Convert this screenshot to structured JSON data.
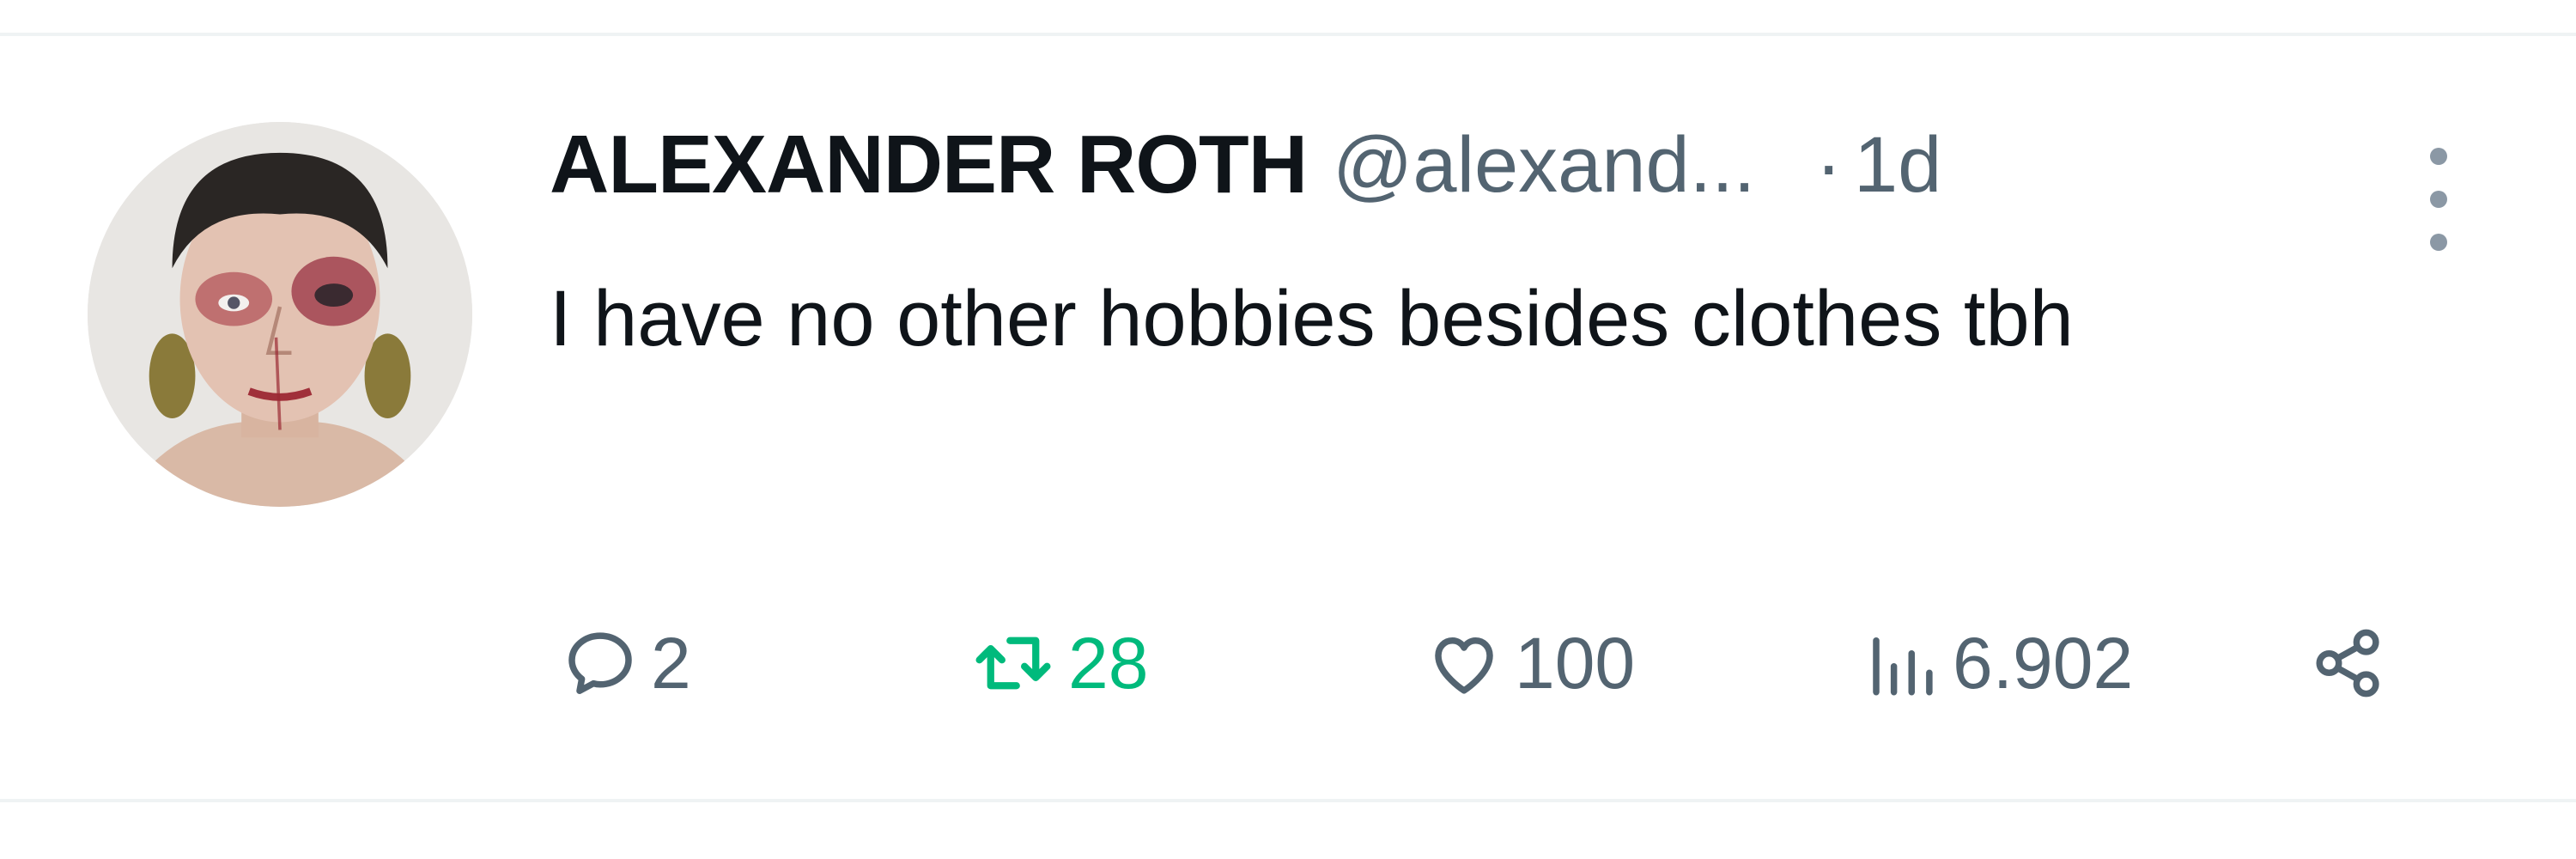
{
  "tweet": {
    "display_name": "ALEXANDER ROTH",
    "handle": "@alexand...",
    "separator": "·",
    "time": "1d",
    "text": "I have no other hobbies besides clothes tbh"
  },
  "actions": {
    "reply_count": "2",
    "retweet_count": "28",
    "like_count": "100",
    "view_count": "6.902"
  },
  "icons": {
    "reply": "reply-icon",
    "retweet": "retweet-icon",
    "like": "heart-icon",
    "views": "views-icon",
    "share": "share-icon",
    "more": "more-icon"
  },
  "colors": {
    "text_primary": "#0f1419",
    "text_secondary": "#536471",
    "retweet_active": "#00ba7c",
    "divider": "#eff3f4"
  }
}
